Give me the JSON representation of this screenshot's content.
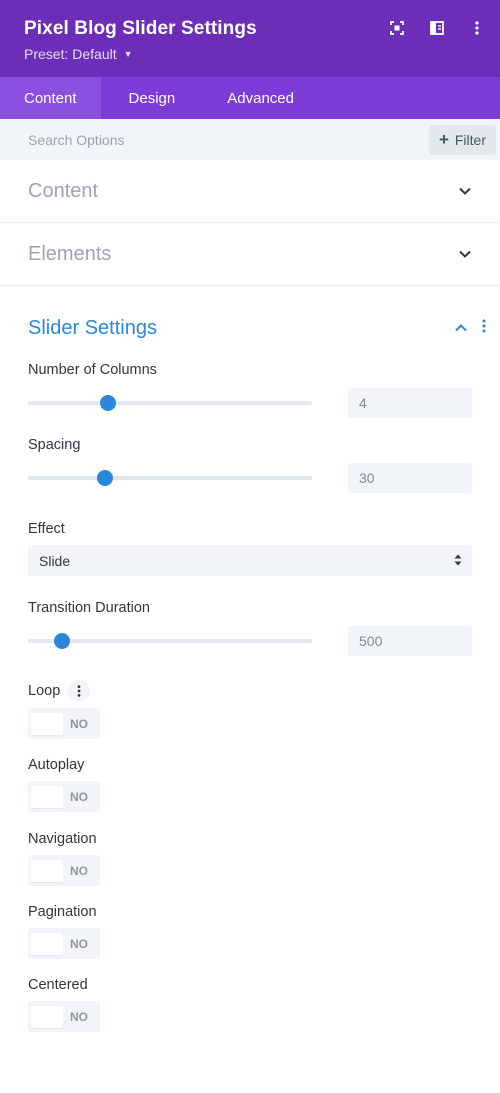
{
  "header": {
    "title": "Pixel Blog Slider Settings",
    "preset_label": "Preset: Default",
    "icons": [
      "expand-icon",
      "split-view-icon",
      "more-vertical-icon"
    ]
  },
  "tabs": [
    {
      "label": "Content",
      "active": true
    },
    {
      "label": "Design",
      "active": false
    },
    {
      "label": "Advanced",
      "active": false
    }
  ],
  "search": {
    "placeholder": "Search Options",
    "filter_label": "Filter"
  },
  "sections": {
    "content": {
      "title": "Content"
    },
    "elements": {
      "title": "Elements"
    },
    "slider": {
      "title": "Slider Settings",
      "columns": {
        "label": "Number of Columns",
        "value": "4",
        "level": 0.28
      },
      "spacing": {
        "label": "Spacing",
        "value": "30",
        "level": 0.27
      },
      "effect": {
        "label": "Effect",
        "value": "Slide"
      },
      "duration": {
        "label": "Transition Duration",
        "value": "500",
        "level": 0.12
      },
      "loop": {
        "label": "Loop",
        "state": "NO"
      },
      "autoplay": {
        "label": "Autoplay",
        "state": "NO"
      },
      "navigation": {
        "label": "Navigation",
        "state": "NO"
      },
      "pagination": {
        "label": "Pagination",
        "state": "NO"
      },
      "centered": {
        "label": "Centered",
        "state": "NO"
      }
    }
  },
  "colors": {
    "header_bg": "#6c2eb9",
    "tabs_bg": "#7d3bd8",
    "accent_blue": "#2b87da"
  }
}
